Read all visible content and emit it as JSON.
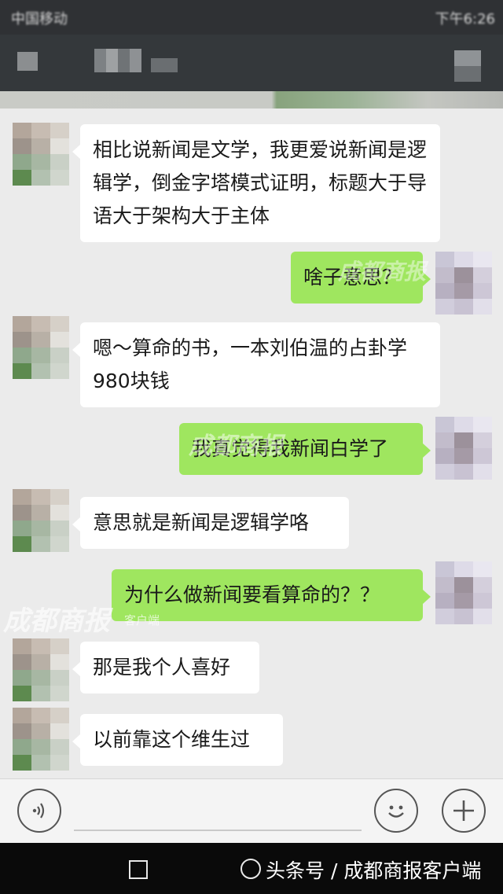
{
  "status_bar": {
    "left_text": "中国移动",
    "right_text": "下午6:26"
  },
  "colors": {
    "sent_bubble": "#9fe65f",
    "received_bubble": "#ffffff",
    "chat_background": "#ebebeb",
    "header": "#34383b"
  },
  "messages": [
    {
      "side": "received",
      "text": "相比说新闻是文学，我更爱说新闻是逻辑学，倒金字塔模式证明，标题大于导语大于架构大于主体"
    },
    {
      "side": "sent",
      "text": "啥子意思？"
    },
    {
      "side": "received",
      "text": "嗯～算命的书，一本刘伯温的占卦学980块钱"
    },
    {
      "side": "sent",
      "text": "我真觉得我新闻白学了"
    },
    {
      "side": "received",
      "text": "意思就是新闻是逻辑学咯"
    },
    {
      "side": "sent",
      "text": "为什么做新闻要看算命的？？"
    },
    {
      "side": "received",
      "text": "那是我个人喜好"
    },
    {
      "side": "received",
      "text": "以前靠这个维生过"
    }
  ],
  "watermarks": {
    "logo": "成都商报",
    "sub": "客户端"
  },
  "input_bar": {
    "voice_icon": "voice-icon",
    "emoji_icon": "emoji-icon",
    "plus_icon": "plus-icon"
  },
  "nav_bar": {
    "caption": "头条号 / 成都商报客户端"
  }
}
